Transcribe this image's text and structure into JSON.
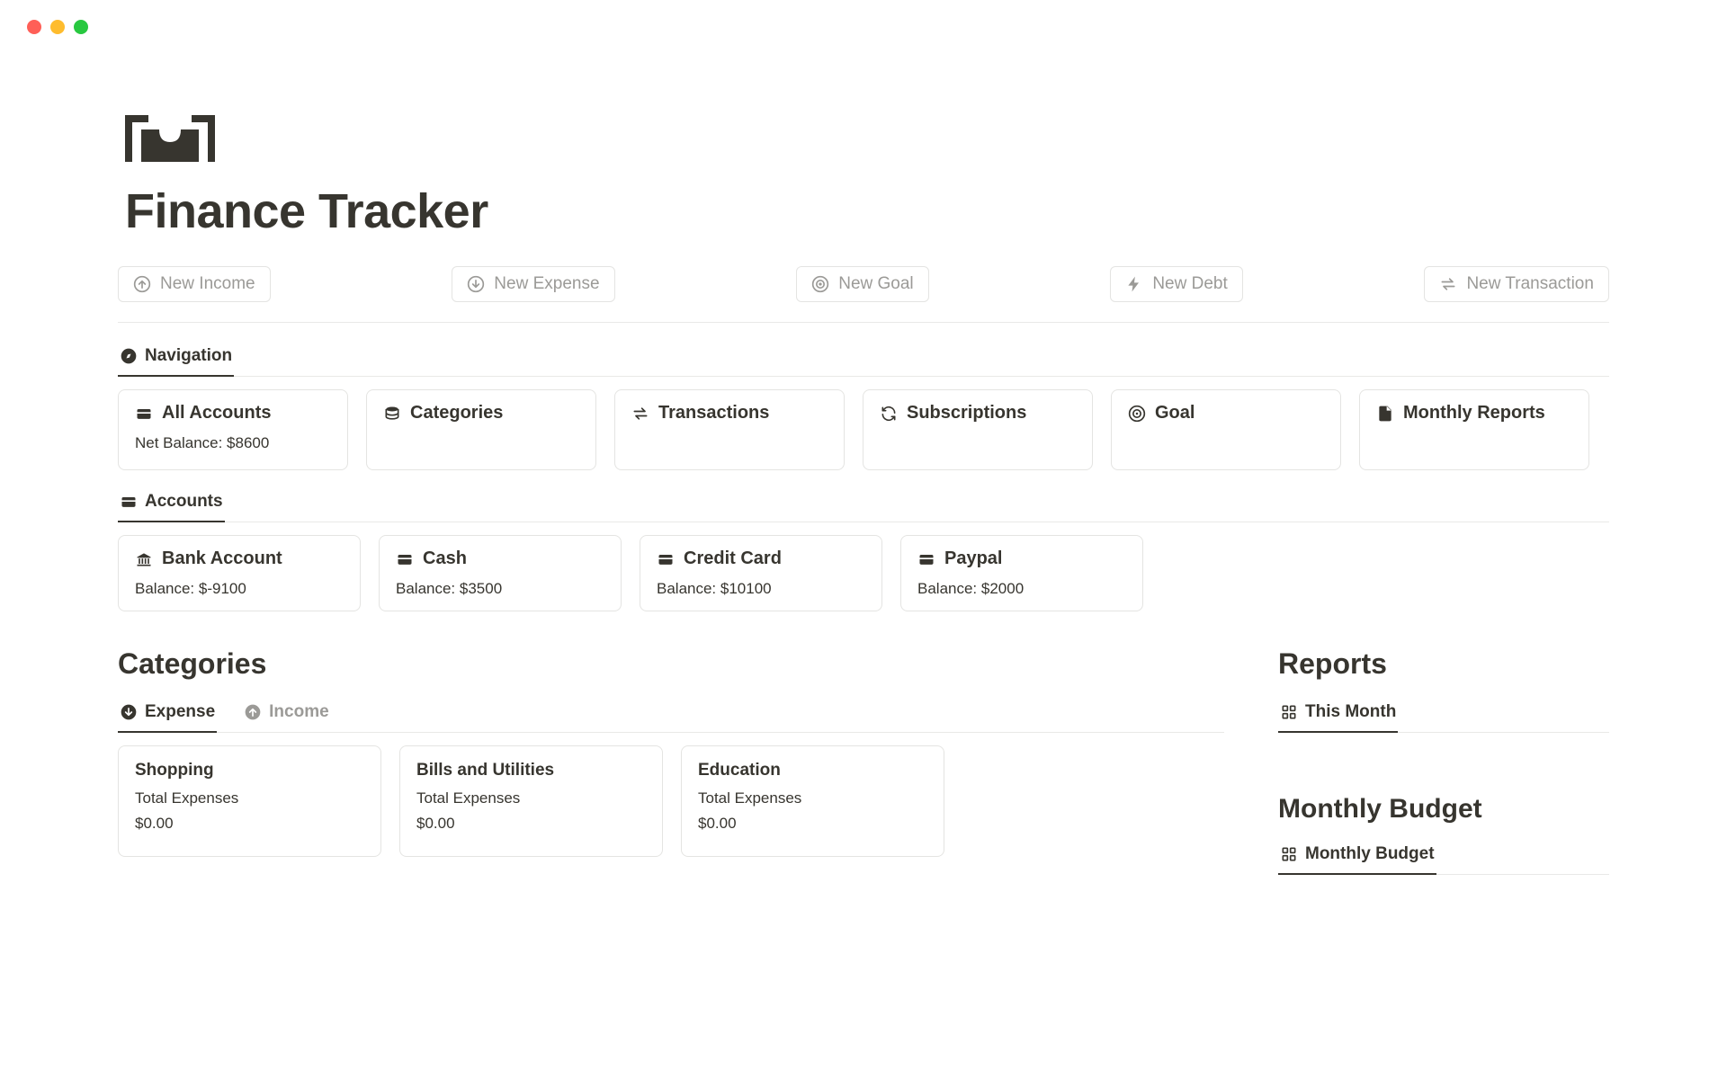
{
  "page": {
    "title": "Finance Tracker"
  },
  "actions": [
    {
      "label": "New Income",
      "icon": "arrow-up-circle-icon"
    },
    {
      "label": "New Expense",
      "icon": "arrow-down-circle-icon"
    },
    {
      "label": "New Goal",
      "icon": "target-icon"
    },
    {
      "label": "New Debt",
      "icon": "bolt-icon"
    },
    {
      "label": "New Transaction",
      "icon": "swap-icon"
    }
  ],
  "navigation": {
    "tab_label": "Navigation",
    "cards": [
      {
        "label": "All Accounts",
        "sub": "Net Balance: $8600",
        "icon": "wallet-icon"
      },
      {
        "label": "Categories",
        "sub": "",
        "icon": "stack-icon"
      },
      {
        "label": "Transactions",
        "sub": "",
        "icon": "swap-icon"
      },
      {
        "label": "Subscriptions",
        "sub": "",
        "icon": "refresh-icon"
      },
      {
        "label": "Goal",
        "sub": "",
        "icon": "target-icon"
      },
      {
        "label": "Monthly Reports",
        "sub": "",
        "icon": "document-icon"
      }
    ]
  },
  "accounts": {
    "tab_label": "Accounts",
    "cards": [
      {
        "label": "Bank Account",
        "sub": "Balance: $-9100",
        "icon": "bank-icon"
      },
      {
        "label": "Cash",
        "sub": "Balance: $3500",
        "icon": "card-icon"
      },
      {
        "label": "Credit Card",
        "sub": "Balance: $10100",
        "icon": "card-icon"
      },
      {
        "label": "Paypal",
        "sub": "Balance: $2000",
        "icon": "card-icon"
      }
    ]
  },
  "categories": {
    "heading": "Categories",
    "tabs": {
      "expense": "Expense",
      "income": "Income"
    },
    "cards": [
      {
        "label": "Shopping",
        "line1": "Total Expenses",
        "value": "$0.00"
      },
      {
        "label": "Bills and Utilities",
        "line1": "Total Expenses",
        "value": "$0.00"
      },
      {
        "label": "Education",
        "line1": "Total Expenses",
        "value": "$0.00"
      }
    ]
  },
  "reports": {
    "heading": "Reports",
    "tab_label": "This Month",
    "budget_heading": "Monthly Budget",
    "budget_tab_label": "Monthly Budget"
  }
}
